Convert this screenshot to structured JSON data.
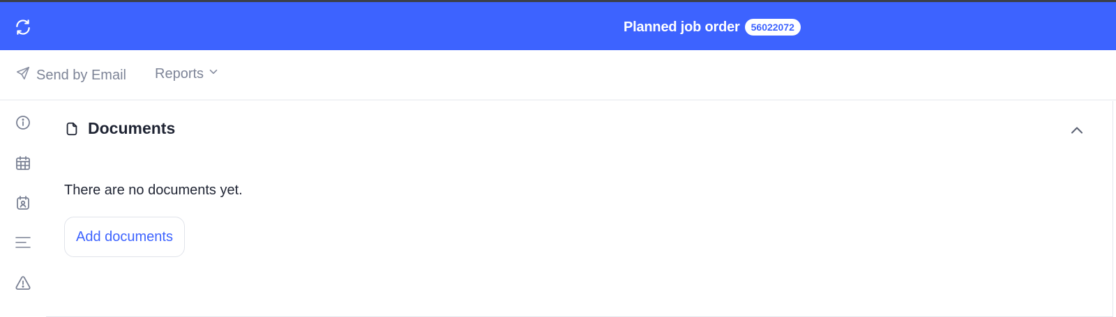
{
  "header": {
    "title": "Planned job order",
    "order_number": "56022072",
    "refresh_icon": "refresh-icon",
    "background": "#3d63ff"
  },
  "toolbar": {
    "send_email_label": "Send by Email",
    "send_email_icon": "paper-plane-icon",
    "reports_label": "Reports",
    "reports_icon": "chevron-down-icon"
  },
  "sidebar": {
    "items": [
      {
        "icon": "info-icon"
      },
      {
        "icon": "calendar-icon"
      },
      {
        "icon": "calendar-user-icon"
      },
      {
        "icon": "menu-lines-icon"
      },
      {
        "icon": "warning-icon"
      }
    ]
  },
  "documents": {
    "title": "Documents",
    "icon": "document-icon",
    "empty_message": "There are no documents yet.",
    "add_button_label": "Add documents",
    "collapse_icon": "chevron-up-icon"
  }
}
